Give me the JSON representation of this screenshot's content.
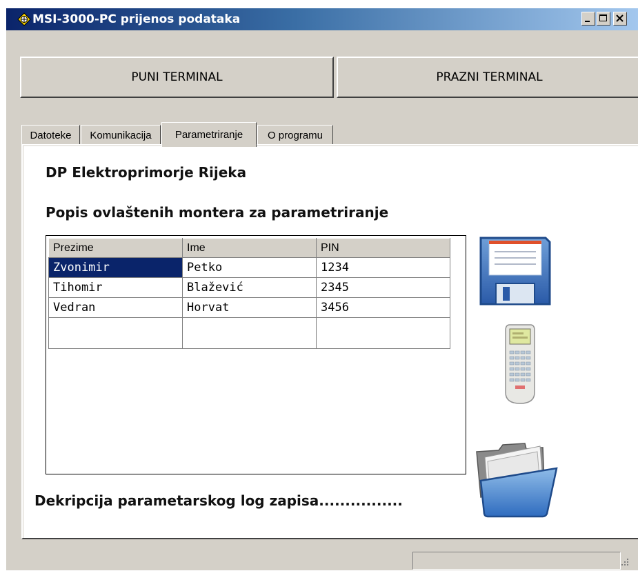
{
  "window": {
    "title": "MSI-3000-PC prijenos podataka",
    "controls": {
      "minimize": "_",
      "maximize": "□",
      "close": "X"
    }
  },
  "toolbar": {
    "full_terminal": "PUNI TERMINAL",
    "empty_terminal": "PRAZNI TERMINAL"
  },
  "tabs": [
    {
      "label": "Datoteke",
      "active": false
    },
    {
      "label": "Komunikacija",
      "active": false
    },
    {
      "label": "Parametriranje",
      "active": true
    },
    {
      "label": "O programu",
      "active": false
    }
  ],
  "panel": {
    "company": "DP Elektroprimorje Rijeka",
    "list_title": "Popis ovlaštenih montera za parametriranje",
    "columns": [
      "Prezime",
      "Ime",
      "PIN"
    ],
    "rows": [
      [
        "Zvonimir",
        "Petko",
        "1234"
      ],
      [
        "Tihomir",
        "Blažević",
        "2345"
      ],
      [
        "Vedran",
        "Horvat",
        "3456"
      ]
    ],
    "selected_cell": "Zvonimir",
    "decrypt_label": "Dekripcija parametarskog log zapisa................",
    "icons": [
      "save-icon",
      "terminal-icon",
      "open-folder-icon"
    ]
  },
  "colors": {
    "title_bar_start": "#0a246a",
    "title_bar_end": "#a6caf0",
    "selection": "#0a246a",
    "face": "#d4d0c8"
  }
}
